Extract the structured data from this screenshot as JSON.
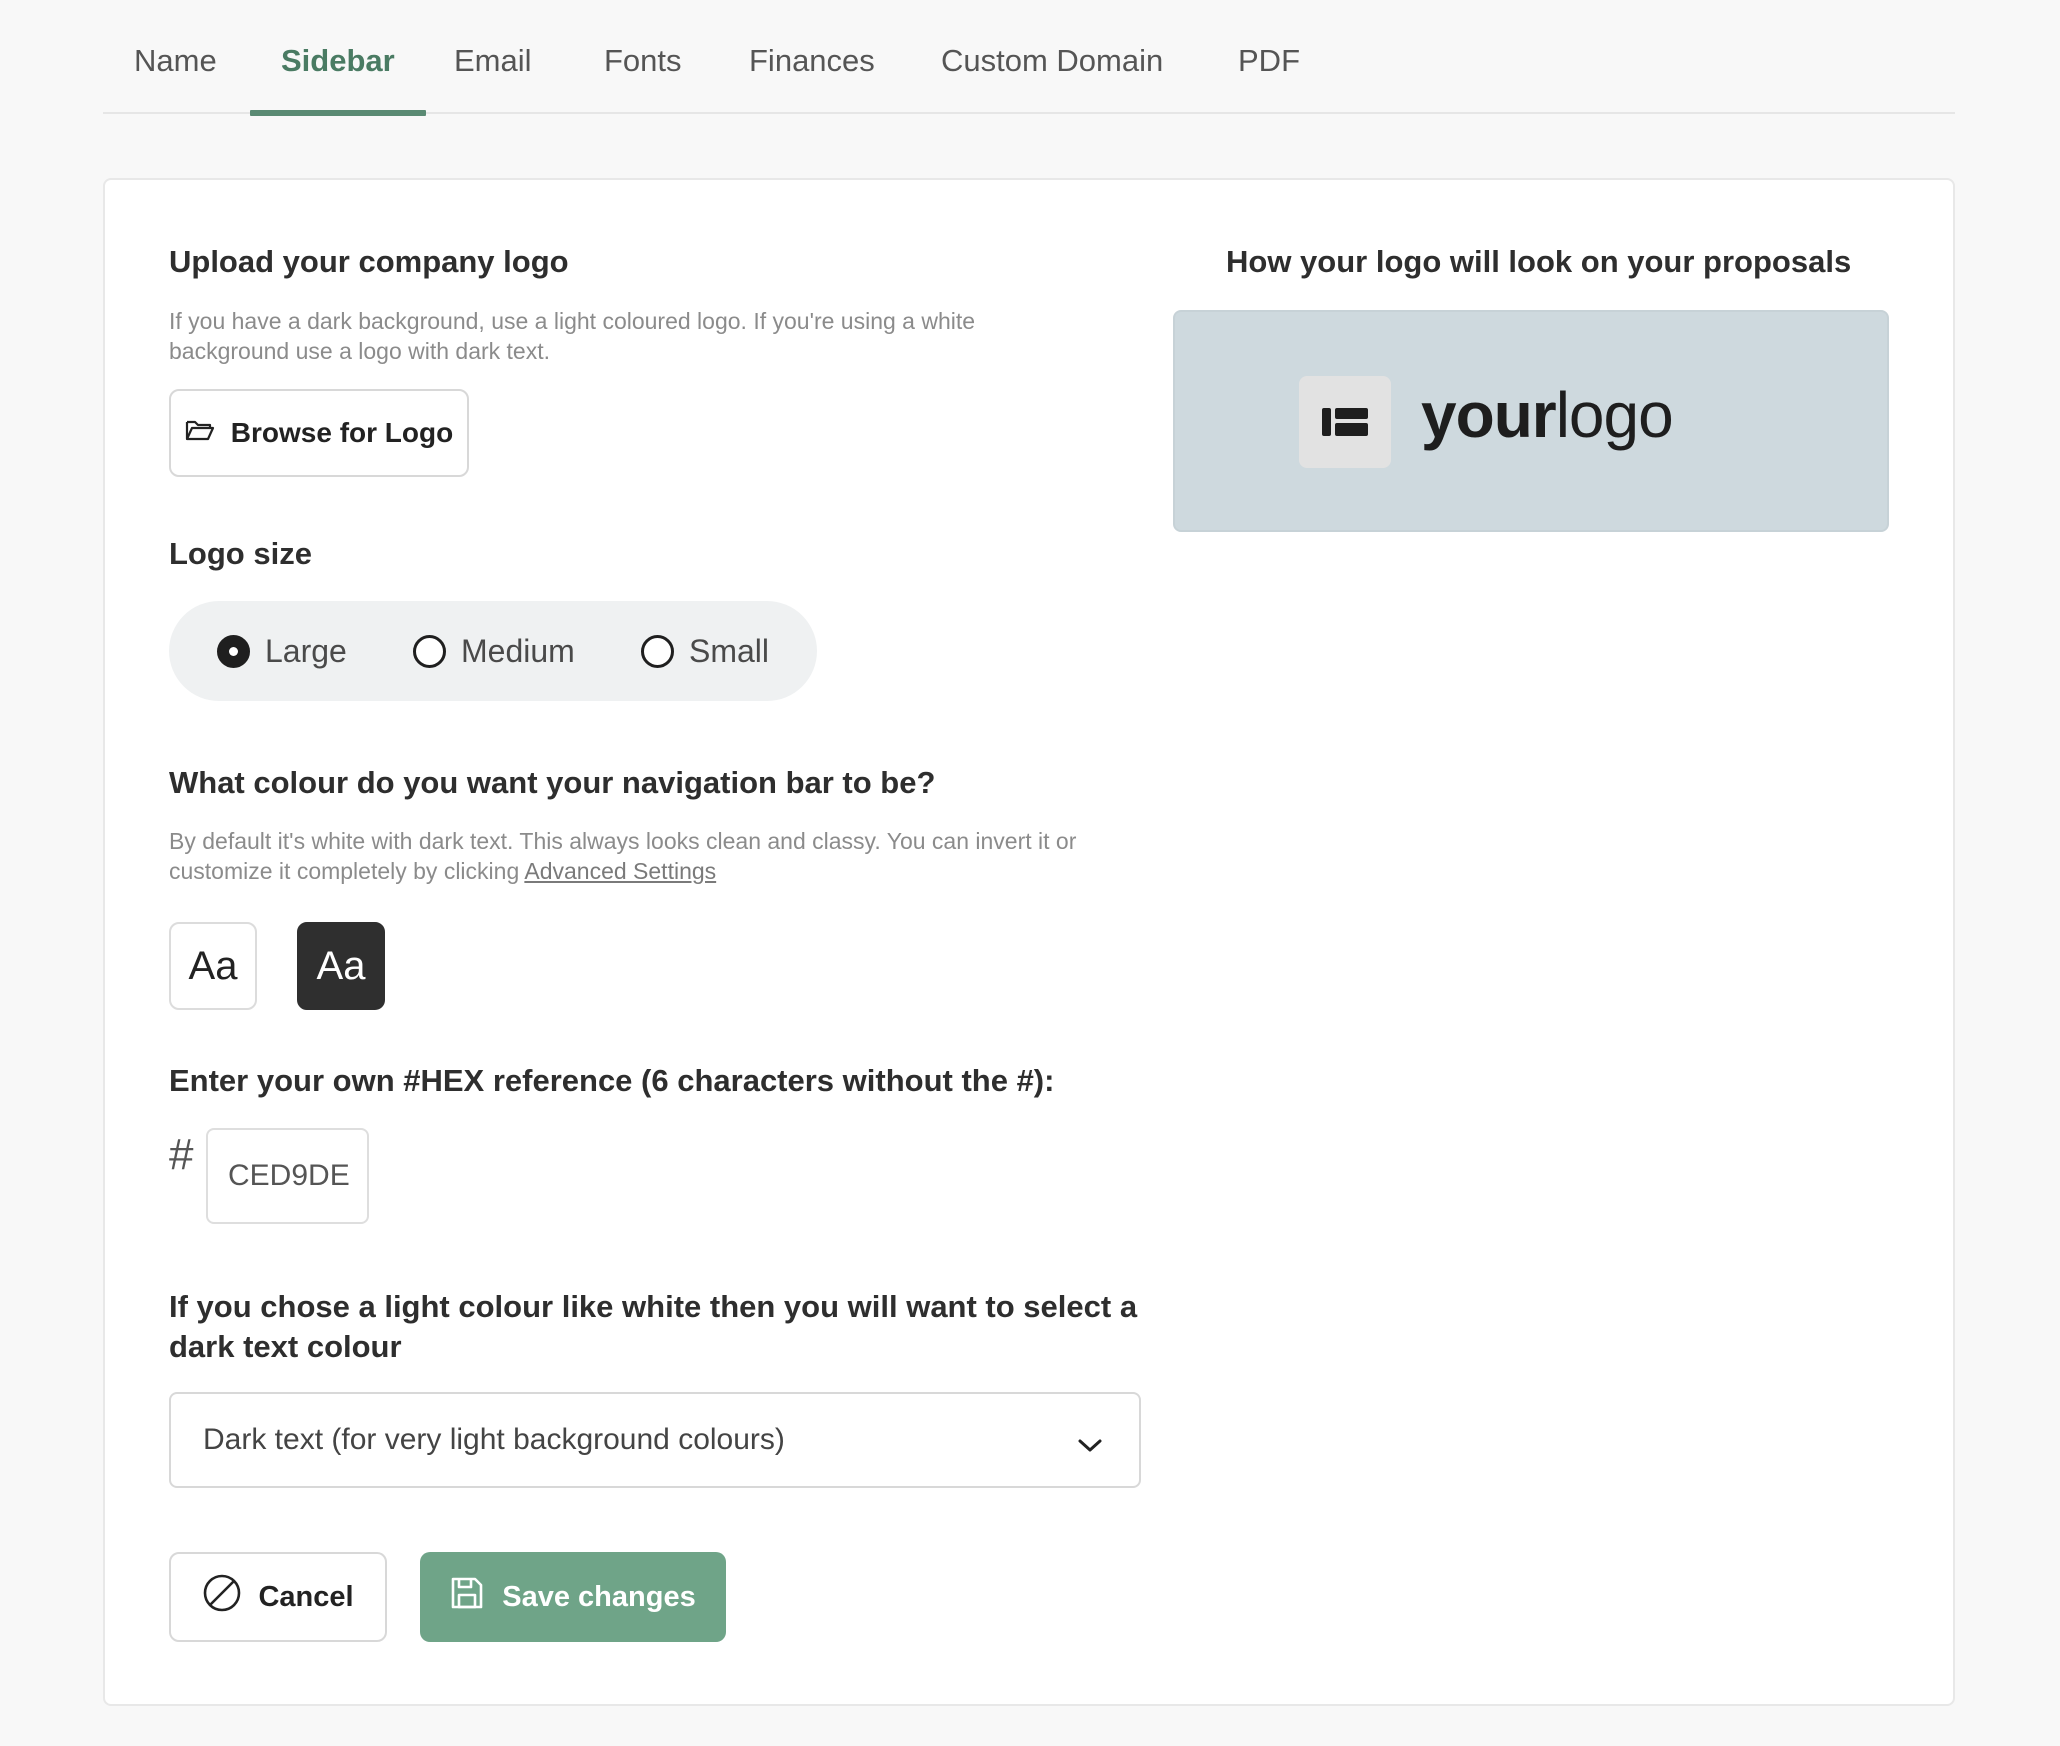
{
  "tabs": [
    {
      "label": "Name"
    },
    {
      "label": "Sidebar"
    },
    {
      "label": "Email"
    },
    {
      "label": "Fonts"
    },
    {
      "label": "Finances"
    },
    {
      "label": "Custom Domain"
    },
    {
      "label": "PDF"
    }
  ],
  "active_tab": "Sidebar",
  "logo_upload": {
    "heading": "Upload your company logo",
    "help": "If you have a dark background, use a light coloured logo. If you're using a white background use a logo with dark text.",
    "browse_label": "Browse for Logo",
    "browse_icon": "folder-open-icon"
  },
  "logo_size": {
    "heading": "Logo size",
    "options": [
      {
        "label": "Large",
        "selected": true
      },
      {
        "label": "Medium",
        "selected": false
      },
      {
        "label": "Small",
        "selected": false
      }
    ]
  },
  "nav_colour": {
    "heading": "What colour do you want your navigation bar to be?",
    "help_prefix": "By default it's white with dark text. This always looks clean and classy. You can invert it or customize it completely by clicking ",
    "help_link": "Advanced Settings",
    "swatch_light_label": "Aa",
    "swatch_dark_label": "Aa"
  },
  "hex": {
    "heading": "Enter your own #HEX reference (6 characters without the #):",
    "prefix": "#",
    "value": "CED9DE"
  },
  "text_colour": {
    "heading": "If you chose a light colour like white then you will want to select a dark text colour",
    "selected": "Dark text (for very light background colours)"
  },
  "actions": {
    "cancel_label": "Cancel",
    "save_label": "Save changes"
  },
  "preview": {
    "heading": "How your logo will look on your proposals",
    "logo_bold": "your",
    "logo_light": "logo",
    "background_color": "#CED9DE"
  },
  "colors": {
    "accent": "#6fa488",
    "active_tab": "#4a7b63",
    "dark_swatch": "#2f2f2f"
  }
}
